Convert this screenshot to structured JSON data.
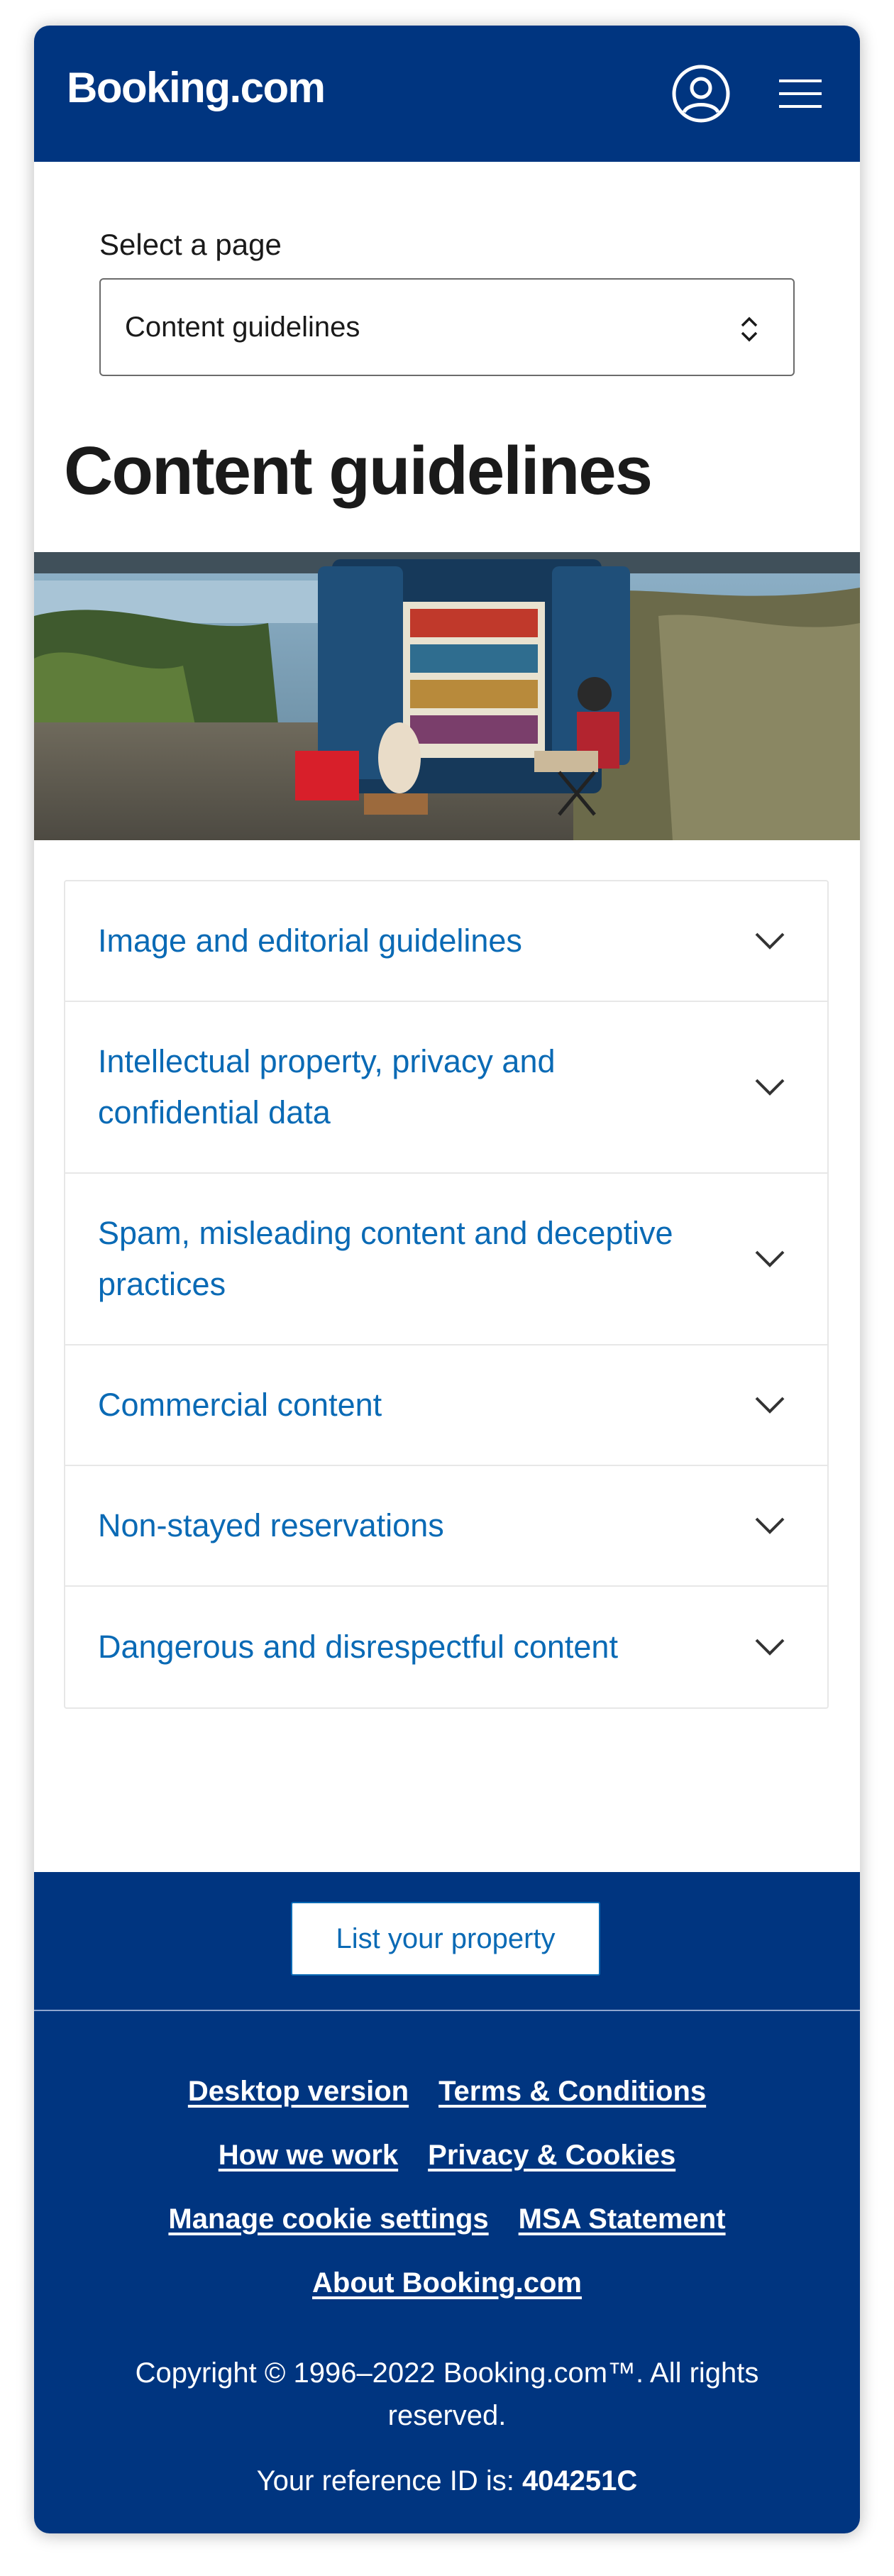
{
  "header": {
    "logo": "Booking.com",
    "account_icon": "account-circle-icon",
    "menu_icon": "hamburger-menu-icon"
  },
  "select": {
    "label": "Select a page",
    "value": "Content guidelines",
    "icon": "chevron-up-down-icon"
  },
  "page": {
    "title": "Content guidelines"
  },
  "hero": {
    "icon": "hero-photo-van-library"
  },
  "accordion": {
    "items": [
      {
        "label": "Image and editorial guidelines"
      },
      {
        "label": "Intellectual property, privacy and confidential data"
      },
      {
        "label": "Spam, misleading content and deceptive practices"
      },
      {
        "label": "Commercial content"
      },
      {
        "label": "Non-stayed reservations"
      },
      {
        "label": "Dangerous and disrespectful content"
      }
    ],
    "chevron_icon": "chevron-down-icon"
  },
  "footer": {
    "list_property": "List your property",
    "links": {
      "desktop": "Desktop version",
      "terms": "Terms & Conditions",
      "how": "How we work",
      "privacy": "Privacy & Cookies",
      "cookie_settings": "Manage cookie settings",
      "msa": "MSA Statement",
      "about": "About Booking.com"
    },
    "copyright": "Copyright © 1996–2022 Booking.com™. All rights reserved.",
    "reference_prefix": "Your reference ID is: ",
    "reference_id": "404251C"
  },
  "colors": {
    "brand_blue": "#003580",
    "link_blue": "#0a6ab5"
  }
}
